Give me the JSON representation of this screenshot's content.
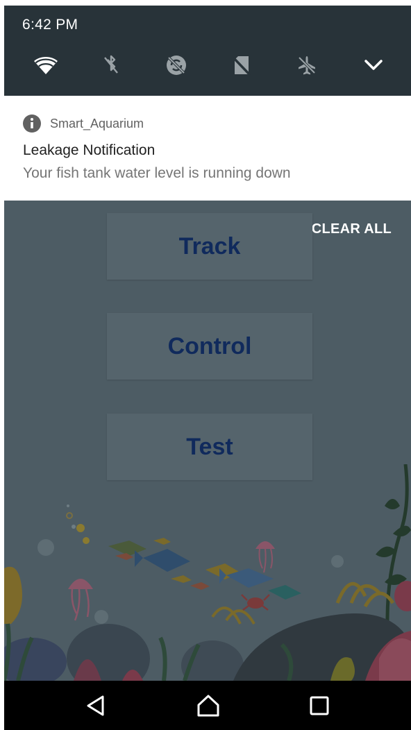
{
  "status_bar": {
    "time": "6:42 PM"
  },
  "quick_settings": [
    {
      "name": "wifi-icon",
      "state": "on"
    },
    {
      "name": "bluetooth-off-icon",
      "state": "off"
    },
    {
      "name": "sync-off-icon",
      "state": "off"
    },
    {
      "name": "no-sim-icon",
      "state": "off"
    },
    {
      "name": "airplane-mode-off-icon",
      "state": "off"
    },
    {
      "name": "chevron-down-icon",
      "state": "expand"
    }
  ],
  "notification": {
    "app_name": "Smart_Aquarium",
    "app_icon": "info-icon",
    "title": "Leakage Notification",
    "text": "Your fish tank water level is running down"
  },
  "shade_actions": {
    "clear_all": "CLEAR ALL"
  },
  "app": {
    "buttons": [
      {
        "label": "Track"
      },
      {
        "label": "Control"
      },
      {
        "label": "Test"
      }
    ]
  },
  "nav_bar": [
    {
      "name": "back-icon"
    },
    {
      "name": "home-icon"
    },
    {
      "name": "recents-icon"
    }
  ],
  "colors": {
    "shade_bg": "#283339",
    "notification_bg": "#ffffff",
    "app_dimmed_bg": "#4d5c64",
    "button_text": "#102a5c",
    "nav_bg": "#000000"
  }
}
